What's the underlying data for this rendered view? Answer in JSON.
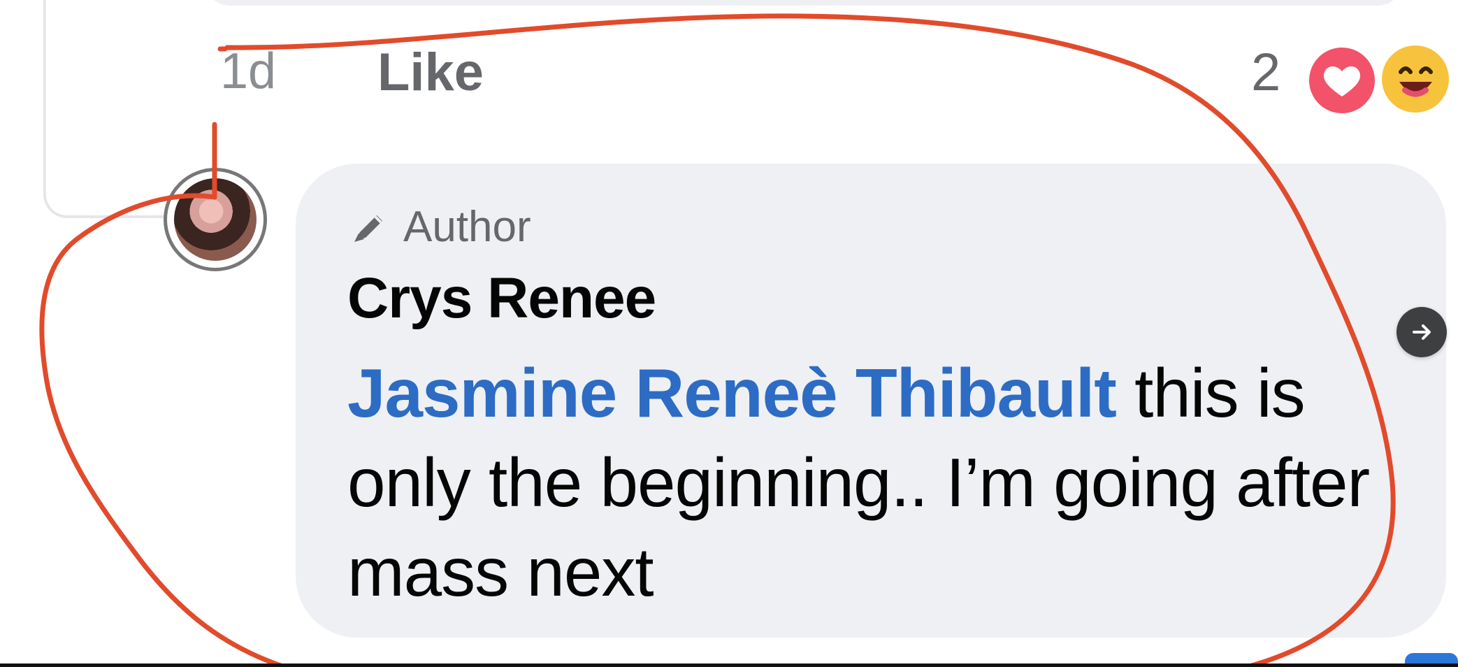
{
  "comment_meta": {
    "time": "1d",
    "like_label": "Like",
    "reaction_count": "2"
  },
  "reply": {
    "author_badge": "Author",
    "name": "Crys Renee",
    "mention": "Jasmine Reneè Thibault",
    "text": " this is only the beginning.. I’m going after mass next"
  },
  "icons": {
    "reaction_1": "heart-icon",
    "reaction_2": "haha-icon",
    "author": "pen-icon",
    "next": "arrow-right-icon"
  },
  "colors": {
    "bubble": "#eef0f3",
    "mention": "#2d6cc4",
    "annotation": "#e14b2b"
  }
}
